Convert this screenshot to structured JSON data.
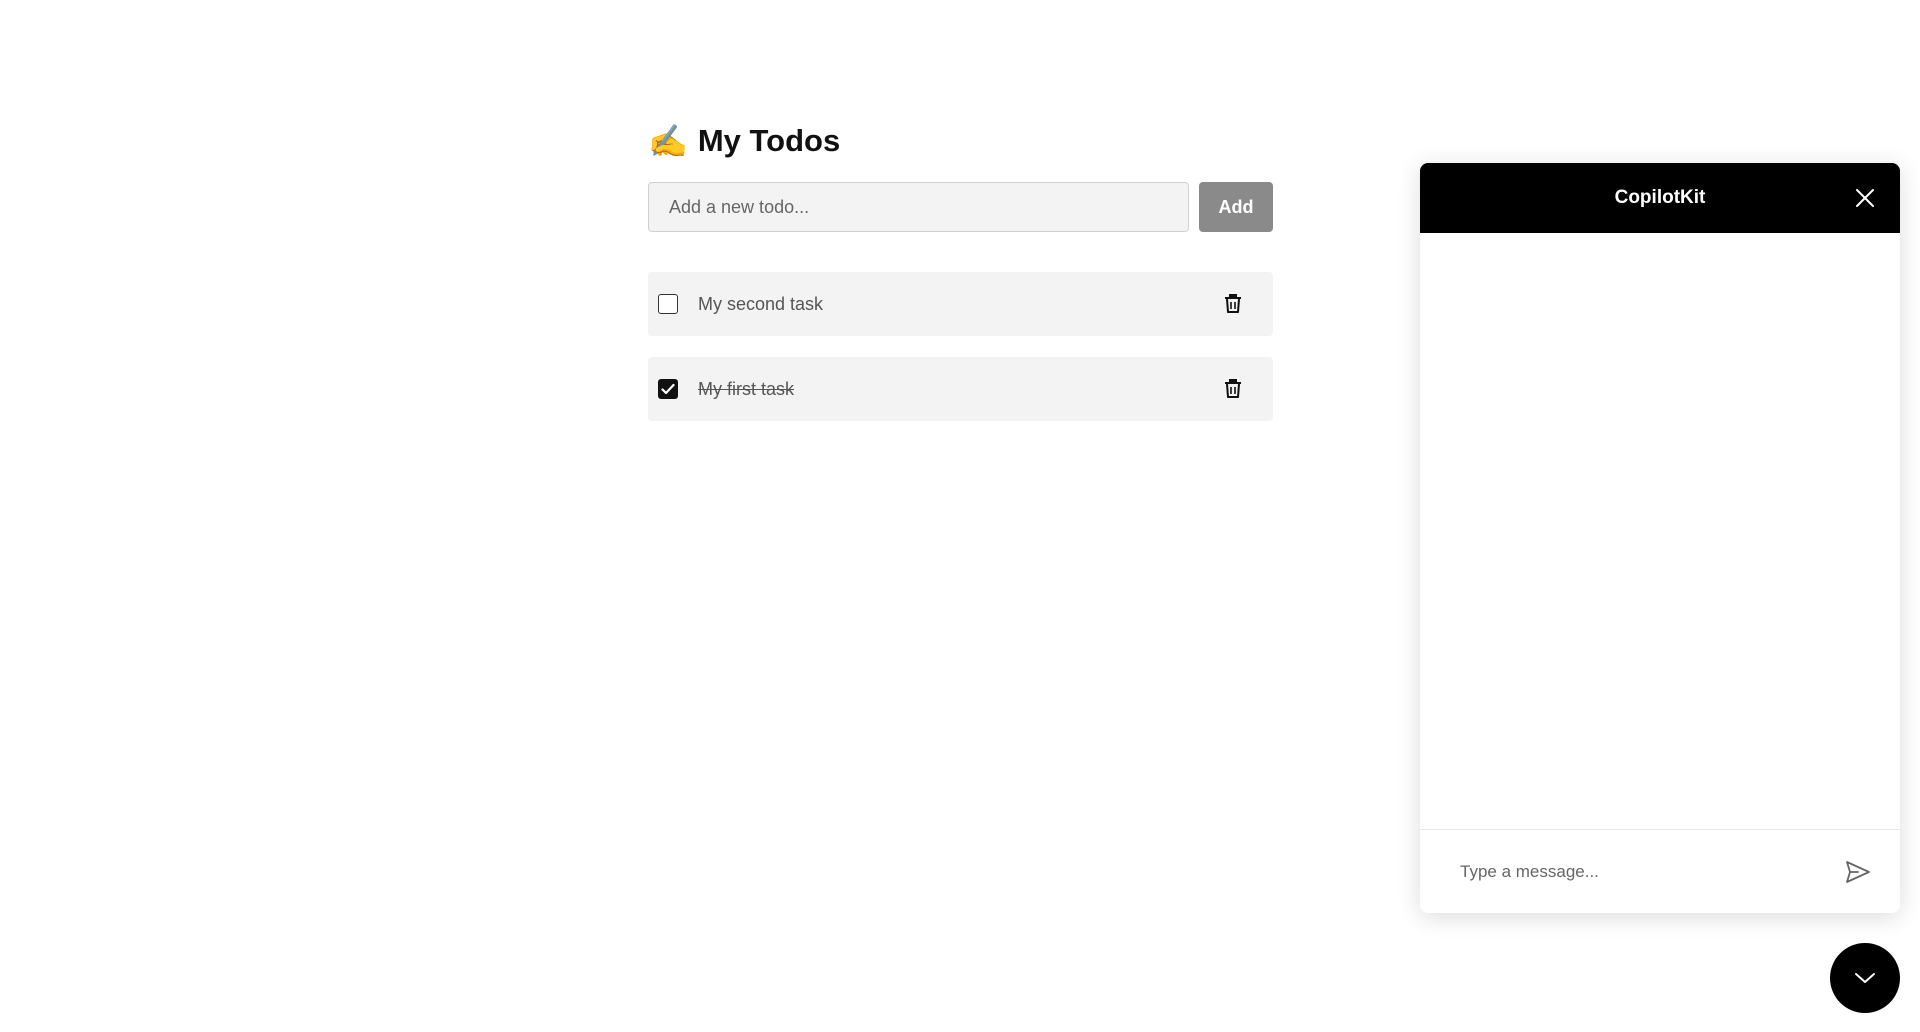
{
  "todo": {
    "title_emoji": "✍️",
    "title": "My Todos",
    "input_placeholder": "Add a new todo...",
    "input_value": "",
    "add_label": "Add",
    "items": [
      {
        "text": "My second task",
        "completed": false
      },
      {
        "text": "My first task",
        "completed": true
      }
    ]
  },
  "copilot": {
    "title": "CopilotKit",
    "message_placeholder": "Type a message...",
    "message_value": ""
  },
  "icons": {
    "title": "writing-hand-icon",
    "delete": "trash-icon",
    "close": "close-icon",
    "send": "send-icon",
    "toggle": "chevron-down-icon",
    "check": "check-icon"
  },
  "colors": {
    "header_bg": "#000000",
    "add_button_bg": "#8a8a8a",
    "item_bg": "#f3f3f3"
  }
}
